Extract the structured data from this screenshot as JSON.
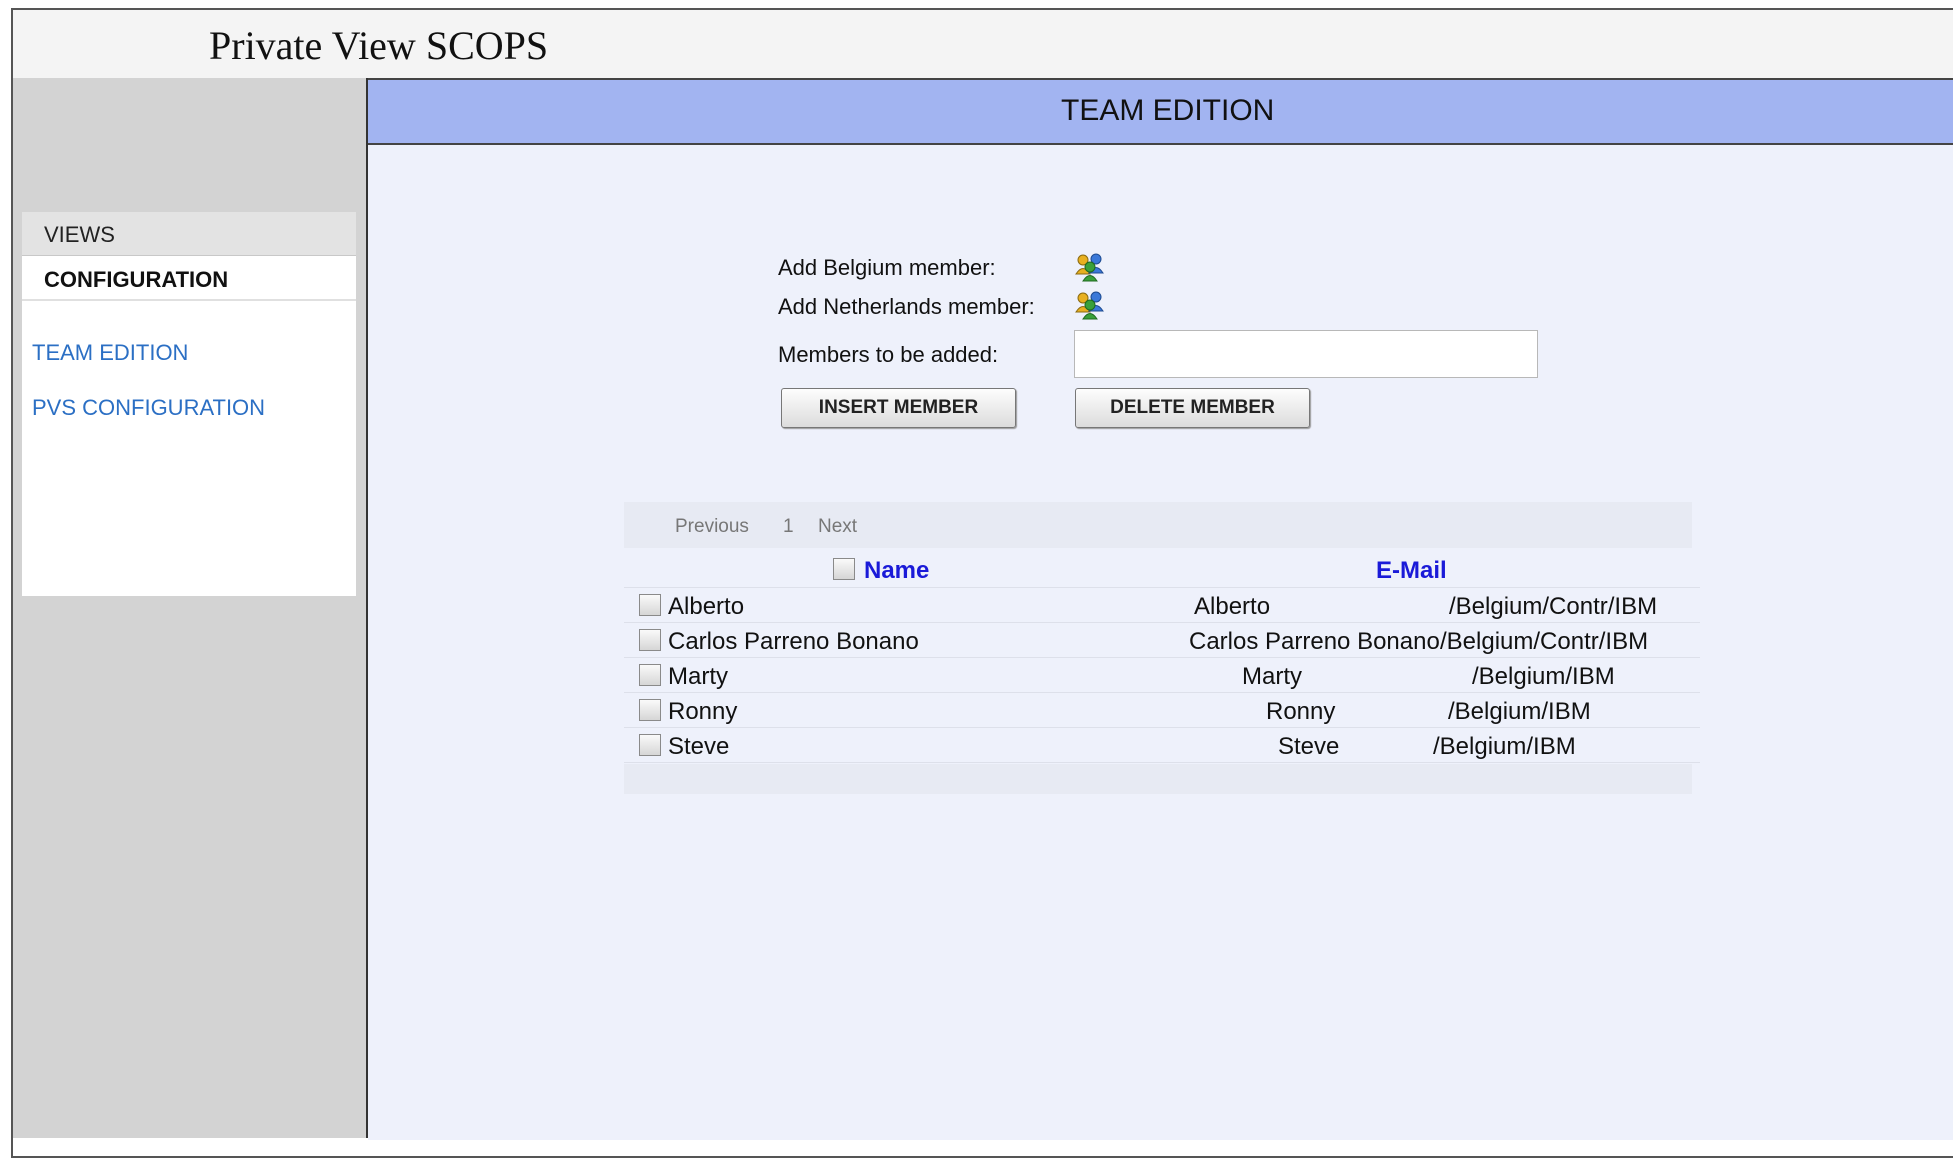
{
  "app": {
    "title": "Private View SCOPS"
  },
  "sidebar": {
    "tabs": [
      {
        "label": "VIEWS"
      },
      {
        "label": "CONFIGURATION"
      }
    ],
    "links": [
      {
        "label": "TEAM EDITION"
      },
      {
        "label": "PVS CONFIGURATION"
      }
    ]
  },
  "page": {
    "header": "TEAM EDITION"
  },
  "form": {
    "add_belgium_label": "Add Belgium member:",
    "add_netherlands_label": "Add Netherlands member:",
    "members_label": "Members to be added:",
    "members_value": "",
    "insert_button": "INSERT MEMBER",
    "delete_button": "DELETE MEMBER",
    "icon": "people-group-icon",
    "icon_colors": [
      "#e8b020",
      "#3aa03a",
      "#3a78d8"
    ]
  },
  "pager": {
    "previous": "Previous",
    "page": "1",
    "next": "Next"
  },
  "table": {
    "columns": {
      "name": "Name",
      "email": "E-Mail"
    },
    "rows": [
      {
        "name": "Alberto",
        "email_name": "Alberto",
        "email_org": "/Belgium/Contr/IBM"
      },
      {
        "name": "Carlos Parreno Bonano",
        "email_name": "Carlos Parreno Bonano",
        "email_org": "/Belgium/Contr/IBM"
      },
      {
        "name": "Marty",
        "email_name": "Marty",
        "email_org": "/Belgium/IBM"
      },
      {
        "name": "Ronny",
        "email_name": "Ronny",
        "email_org": "/Belgium/IBM"
      },
      {
        "name": "Steve",
        "email_name": "Steve",
        "email_org": "/Belgium/IBM"
      }
    ]
  },
  "colors": {
    "header_bg": "#a2b4f1",
    "content_bg": "#eef1fb",
    "sidebar_bg": "#d3d3d3",
    "link": "#2b6fc4",
    "column_header": "#1a1ad8"
  }
}
